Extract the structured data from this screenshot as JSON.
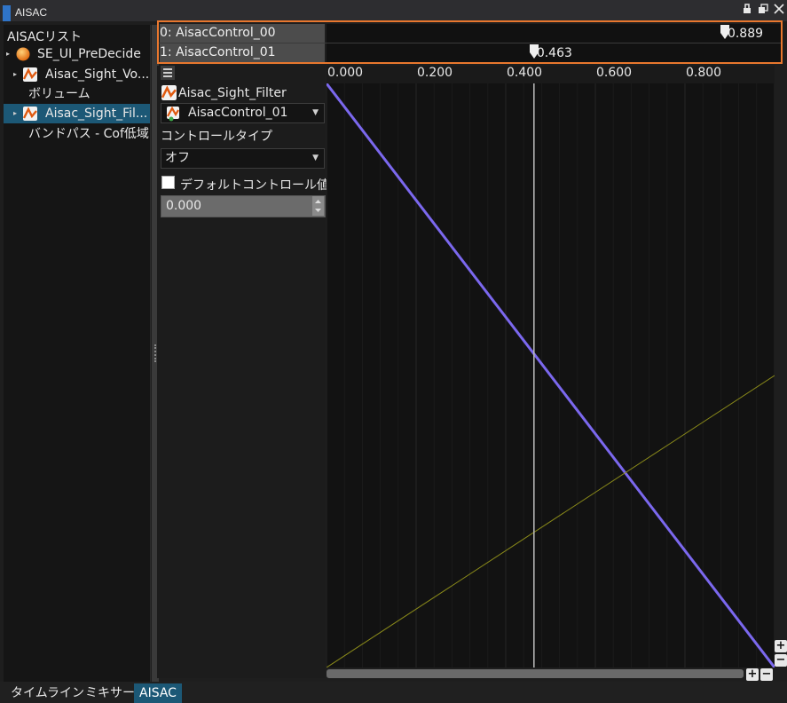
{
  "window": {
    "title": "AISAC",
    "buttons": [
      {
        "name": "pin-icon",
        "glyph": "▯"
      },
      {
        "name": "restore-icon",
        "glyph": "❐"
      },
      {
        "name": "close-icon",
        "glyph": "✕"
      }
    ]
  },
  "left_panel": {
    "header": "AISACリスト",
    "items": [
      {
        "label": "SE_UI_PreDecide",
        "icon": "cue-orb-icon",
        "expander": true
      },
      {
        "label": "Aisac_Sight_Vo...",
        "icon": "aisac-icon",
        "expander": true
      },
      {
        "label": "ボリューム",
        "icon": "",
        "expander": false
      },
      {
        "label": "Aisac_Sight_Fil...",
        "icon": "aisac-icon",
        "expander": true,
        "selected": true
      },
      {
        "label": "バンドパス - Cof低域",
        "icon": "",
        "expander": false
      }
    ]
  },
  "controls": [
    {
      "label": "0: AisacControl_00",
      "value_text": "0.889",
      "value": 0.889
    },
    {
      "label": "1: AisacControl_01",
      "value_text": "0.463",
      "value": 0.463
    }
  ],
  "properties": {
    "aisac_name": "Aisac_Sight_Filter",
    "control_select": "AisacControl_01",
    "control_type_label": "コントロールタイプ",
    "control_type_value": "オフ",
    "default_control_label": "デフォルトコントロール値",
    "default_control_value": "0.000"
  },
  "graph": {
    "x_ticks": [
      "0.000",
      "0.200",
      "0.400",
      "0.600",
      "0.800"
    ],
    "cursor_value": 0.463,
    "curves": [
      {
        "name": "purple-curve",
        "color": "#7b68ee",
        "points": [
          [
            0,
            1
          ],
          [
            1,
            0
          ]
        ]
      },
      {
        "name": "olive-curve",
        "color": "#8a8a1a",
        "points": [
          [
            0,
            0
          ],
          [
            1,
            0.5
          ]
        ]
      }
    ]
  },
  "tabs": [
    "タイムライン",
    "ミキサー",
    "AISAC"
  ],
  "active_tab": "AISAC",
  "colors": {
    "accent_orange": "#e8772e",
    "selection": "#1c5876",
    "title_accent": "#2f74c8"
  }
}
